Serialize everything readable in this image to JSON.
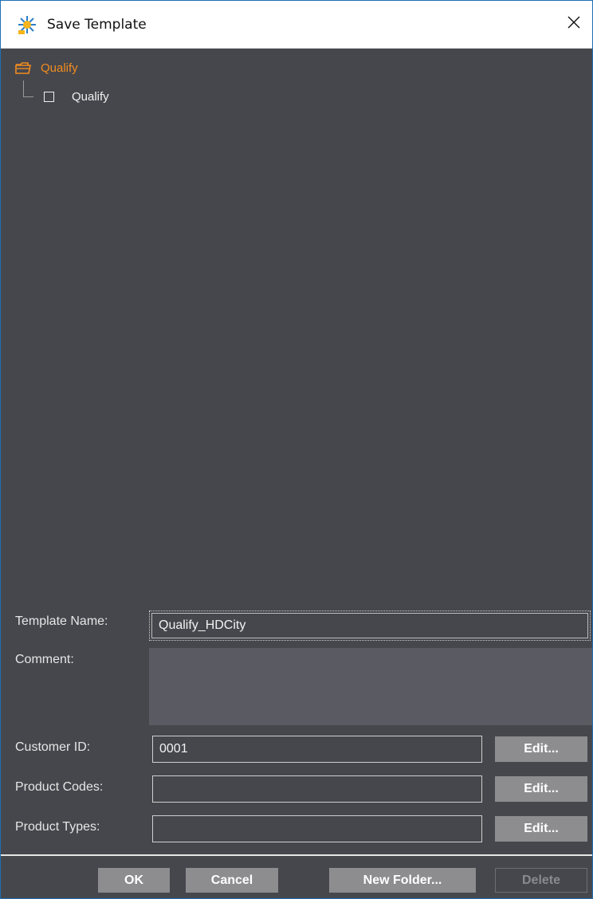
{
  "window": {
    "title": "Save Template",
    "icon": "app-sunburst-icon",
    "close_icon": "close-icon"
  },
  "tree": {
    "root": {
      "label": "Qualify",
      "icon": "open-folder-icon",
      "color": "#f28c1e"
    },
    "children": [
      {
        "label": "Qualify",
        "icon": "checkbox-empty-icon"
      }
    ]
  },
  "form": {
    "template_name_label": "Template Name:",
    "template_name_value": "Qualify_HDCity",
    "comment_label": "Comment:",
    "comment_value": "",
    "customer_id_label": "Customer ID:",
    "customer_id_value": "0001",
    "product_codes_label": "Product Codes:",
    "product_codes_value": "",
    "product_types_label": "Product Types:",
    "product_types_value": "",
    "edit_label": "Edit..."
  },
  "footer": {
    "ok_label": "OK",
    "cancel_label": "Cancel",
    "new_folder_label": "New Folder...",
    "delete_label": "Delete"
  },
  "colors": {
    "panel": "#46474d",
    "button": "#8d8d90",
    "accent": "#f28c1e"
  }
}
